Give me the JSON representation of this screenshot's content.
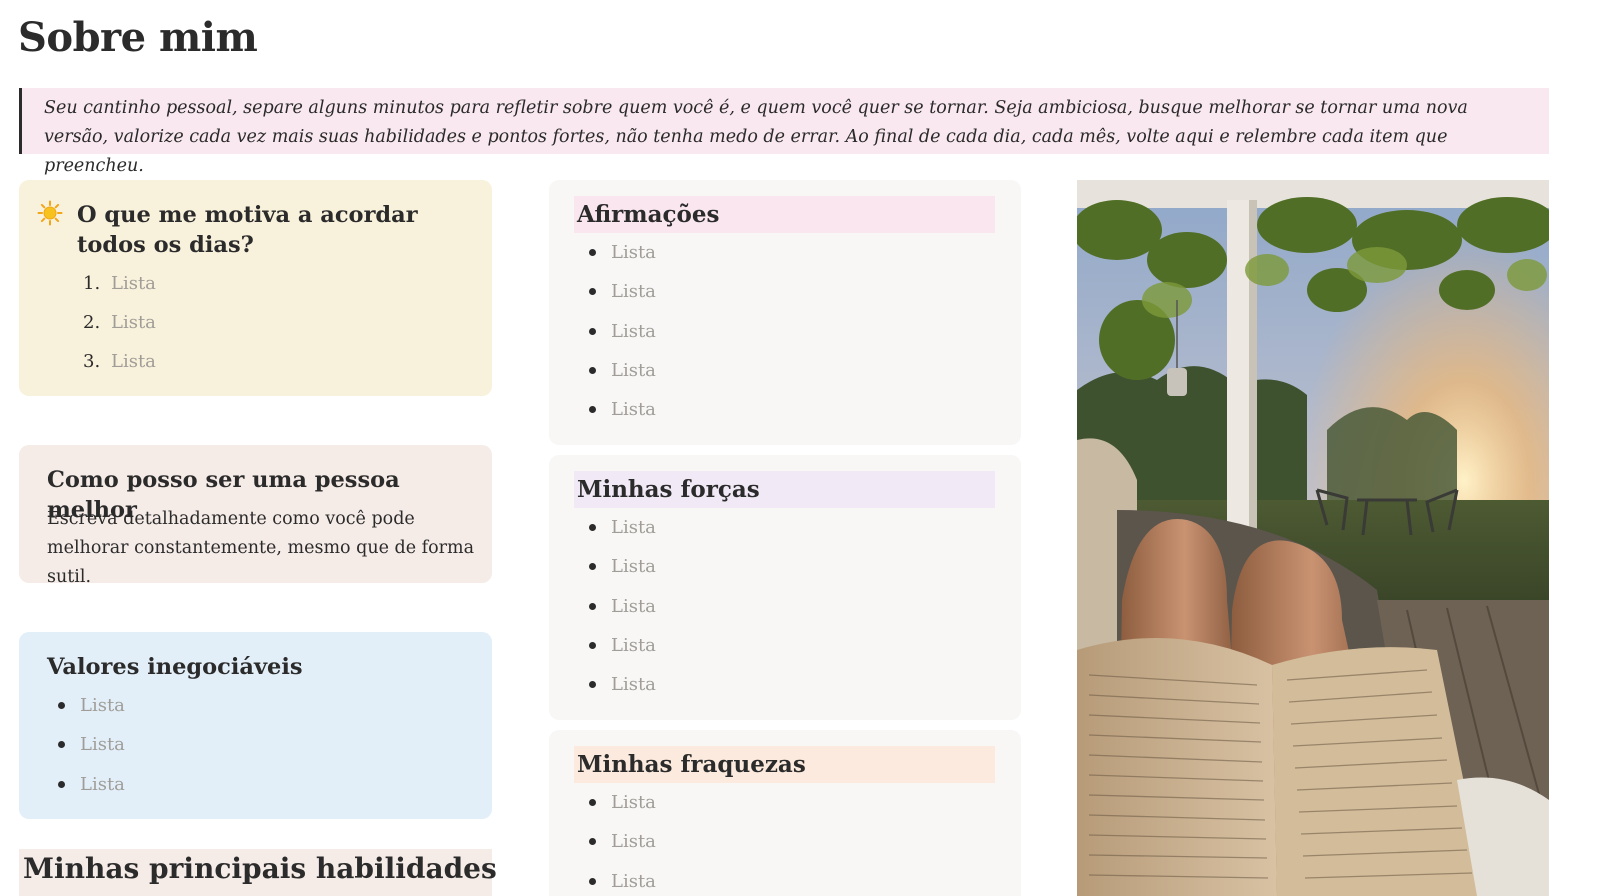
{
  "page": {
    "title": "Sobre mim"
  },
  "intro": {
    "text": "Seu cantinho pessoal, separe alguns minutos para refletir sobre quem você é, e quem você quer se tornar. Seja ambiciosa, busque melhorar se tornar uma nova versão, valorize cada vez mais suas habilidades e pontos fortes, não tenha medo de errar. Ao final de cada dia, cada mês, volte aqui e relembre cada item que preencheu."
  },
  "motivation": {
    "icon": "sun-icon",
    "title": "O que me motiva a acordar todos os dias?",
    "items": [
      {
        "num": "1.",
        "text": "Lista"
      },
      {
        "num": "2.",
        "text": "Lista"
      },
      {
        "num": "3.",
        "text": "Lista"
      }
    ]
  },
  "better": {
    "title": "Como posso ser uma pessoa melhor",
    "description": "Escreva detalhadamente como você pode melhorar constantemente, mesmo que de forma sutil."
  },
  "values": {
    "title": "Valores inegociáveis",
    "items": [
      "Lista",
      "Lista",
      "Lista"
    ]
  },
  "skills": {
    "title": "Minhas principais habilidades"
  },
  "affirmations": {
    "title": "Afirmações",
    "items": [
      "Lista",
      "Lista",
      "Lista",
      "Lista",
      "Lista"
    ]
  },
  "strengths": {
    "title": "Minhas forças",
    "items": [
      "Lista",
      "Lista",
      "Lista",
      "Lista",
      "Lista"
    ]
  },
  "weaknesses": {
    "title": "Minhas fraquezas",
    "items": [
      "Lista",
      "Lista",
      "Lista"
    ]
  },
  "photo": {
    "icon": "reading-book-photo"
  },
  "colors": {
    "quote_bg": "#f9e8ef",
    "motivation_bg": "#f8f1db",
    "better_bg": "#f5ebe7",
    "values_bg": "#e2eff9",
    "list_card_bg": "#f8f7f6",
    "highlight_pink": "#f9e6ef",
    "highlight_purple": "#f1e9f6",
    "highlight_orange": "#fbeadd",
    "placeholder_text": "#a09d98"
  }
}
